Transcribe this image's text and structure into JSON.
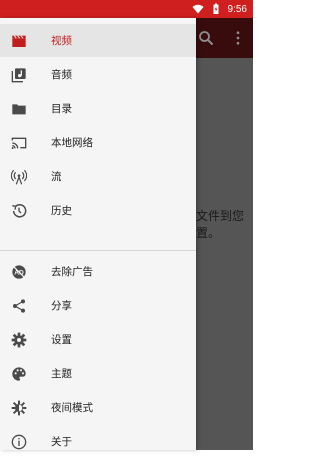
{
  "status_bar": {
    "time": "9:56",
    "color": "#d01f1f"
  },
  "background_app": {
    "toolbar_icons": [
      "search-icon",
      "overflow-menu-icon"
    ],
    "message_line1": "文件到您",
    "message_line2": "置。"
  },
  "drawer": {
    "accent_color": "#c21c1c",
    "items_group1": [
      {
        "label": "视频",
        "icon": "video-clapper-icon",
        "selected": true
      },
      {
        "label": "音频",
        "icon": "audio-library-icon",
        "selected": false
      },
      {
        "label": "目录",
        "icon": "folder-icon",
        "selected": false
      },
      {
        "label": "本地网络",
        "icon": "cast-icon",
        "selected": false
      },
      {
        "label": "流",
        "icon": "stream-antenna-icon",
        "selected": false
      },
      {
        "label": "历史",
        "icon": "history-icon",
        "selected": false
      }
    ],
    "items_group2": [
      {
        "label": "去除广告",
        "icon": "remove-ads-icon"
      },
      {
        "label": "分享",
        "icon": "share-icon"
      },
      {
        "label": "设置",
        "icon": "settings-icon"
      },
      {
        "label": "主题",
        "icon": "palette-icon"
      },
      {
        "label": "夜间模式",
        "icon": "night-mode-icon"
      },
      {
        "label": "关于",
        "icon": "info-icon"
      }
    ]
  }
}
